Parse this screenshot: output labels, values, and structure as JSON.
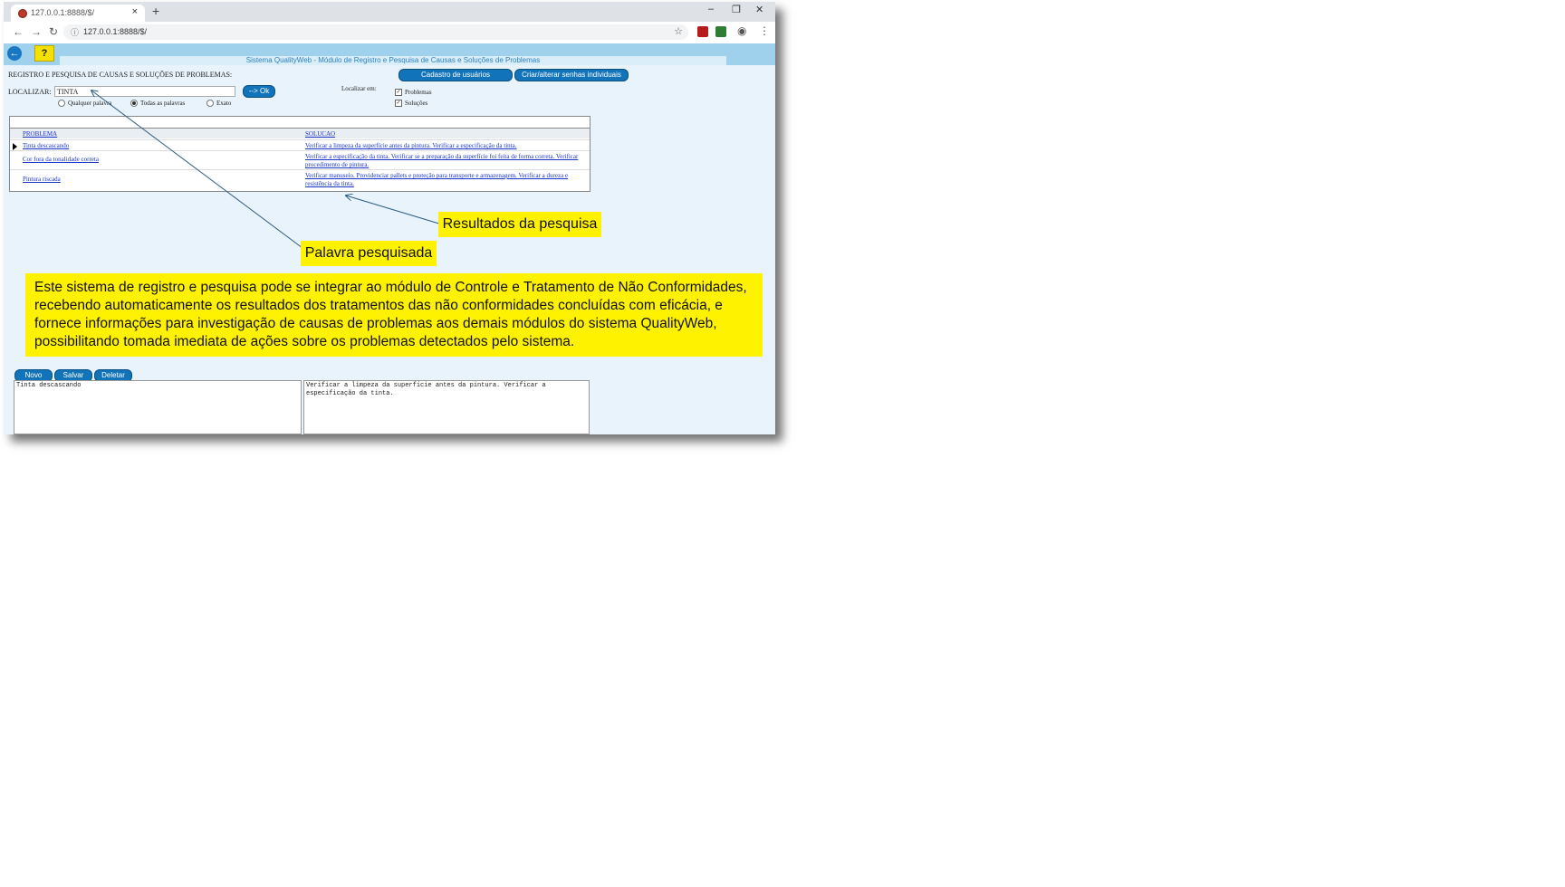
{
  "browser": {
    "tab_title": "127.0.0.1:8888/$/",
    "tab_close": "×",
    "new_tab": "+",
    "url": "127.0.0.1:8888/$/",
    "win_min": "–",
    "win_max": "❐",
    "win_close": "✕",
    "back": "←",
    "forward": "→",
    "reload": "↻",
    "info": "ⓘ",
    "star": "☆",
    "profile": "◉",
    "menu": "⋮"
  },
  "app": {
    "back_icon": "←",
    "help_label": "?",
    "system_title": "Sistema QualityWeb - Módulo de Registro e Pesquisa de Causas e Soluções de Problemas",
    "heading": "REGISTRO E PESQUISA DE CAUSAS E SOLUÇÕES DE PROBLEMAS:",
    "btn_users": "Cadastro de usuários",
    "btn_passwords": "Criar/alterar senhas individuais",
    "search_label": "LOCALIZAR:",
    "search_value": "TINTA",
    "ok_label": "--> Ok",
    "radio_any": "Qualquer palavra",
    "radio_all": "Todas as palavras",
    "radio_exact": "Exato",
    "locate_in": "Localizar em:",
    "chk_problems": "Problemas",
    "chk_solutions": "Soluções",
    "check_mark": "✓",
    "col_problem": "PROBLEMA",
    "col_solution": "SOLUCAO",
    "rows": [
      {
        "problem": "Tinta descascando",
        "solution": "Verificar a limpeza da superfície antes da pintura. Verificar a especificação da tinta."
      },
      {
        "problem": "Cor fora da tonalidade correta",
        "solution": "Verificar a especificação da tinta. Verificar se a preparação da superfície foi feita de forma correta. Verificar procedimento de pintura."
      },
      {
        "problem": "Pintura riscada",
        "solution": "Verificar manuseio. Providenciar pallets e proteção para transporte e armazenagem. Verificar a dureza e resistência da tinta."
      }
    ],
    "btn_new": "Novo",
    "btn_save": "Salvar",
    "btn_delete": "Deletar",
    "ta_problem": "Tinta descascando",
    "ta_solution": "Verificar a limpeza da superfície antes da pintura. Verificar a especificação da tinta."
  },
  "callouts": {
    "results": "Resultados da pesquisa",
    "searched_word": "Palavra pesquisada",
    "description": "Este sistema de registro e pesquisa pode se integrar ao módulo de Controle e Tratamento de Não Conformidades, recebendo automaticamente os resultados dos tratamentos  das não conformidades concluídas com eficácia, e fornece informações para investigação de causas de problemas aos demais módulos do  sistema QualityWeb, possibilitando tomada imediata de ações sobre os problemas detectados pelo sistema."
  }
}
